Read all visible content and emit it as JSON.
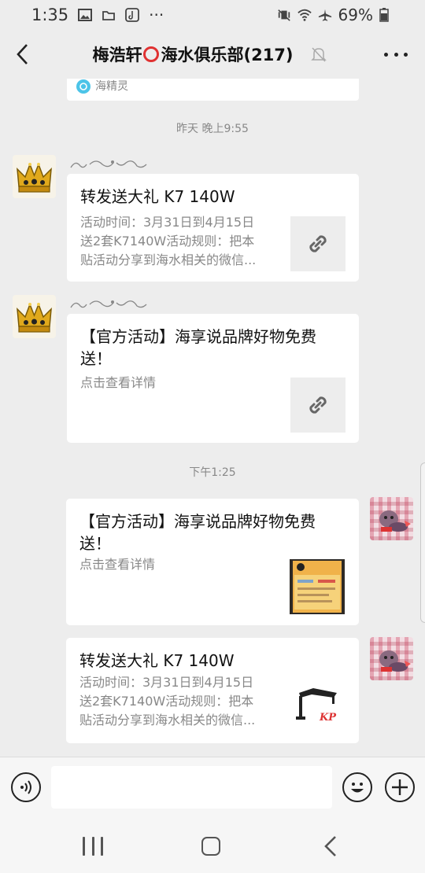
{
  "status_bar": {
    "time": "1:35",
    "dots": "···",
    "battery": "69%"
  },
  "header": {
    "title_prefix": "梅浩轩",
    "title_suffix": "海水俱乐部(217)"
  },
  "messages": {
    "prev_card_source": "海精灵",
    "timestamp_1": "昨天 晚上9:55",
    "timestamp_2": "下午1:25",
    "card_1": {
      "title": "转发送大礼 K7 140W",
      "desc_line1": "活动时间：3月31日到4月15日",
      "desc_line2": "送2套K7140W活动规则：把本",
      "desc_line3": "贴活动分享到海水相关的微信..."
    },
    "card_2": {
      "title": "【官方活动】海享说品牌好物免费送！",
      "desc": "点击查看详情"
    },
    "card_3": {
      "title": "【官方活动】海享说品牌好物免费送！",
      "desc": "点击查看详情"
    },
    "card_4": {
      "title": "转发送大礼 K7 140W",
      "desc_line1": "活动时间：3月31日到4月15日",
      "desc_line2": "送2套K7140W活动规则：把本",
      "desc_line3": "贴活动分享到海水相关的微信...",
      "thumb_brand": "KP"
    }
  },
  "input_bar": {
    "value": ""
  },
  "colors": {
    "background": "#ededed",
    "card": "#ffffff",
    "accent_red": "#e03131"
  }
}
